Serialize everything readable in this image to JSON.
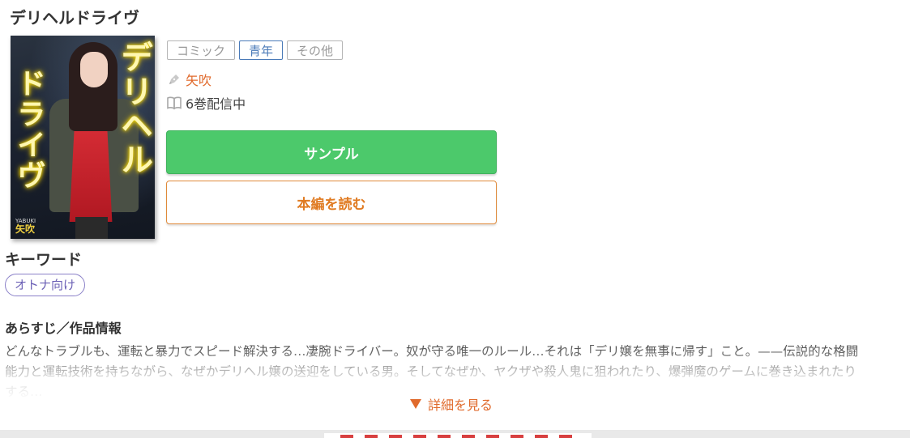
{
  "title": "デリヘルドライヴ",
  "cover": {
    "title_right": "デリヘル",
    "title_left": "ドライヴ",
    "brand": "YABUKI",
    "author": "矢吹"
  },
  "genres": [
    {
      "label": "コミック",
      "active": false
    },
    {
      "label": "青年",
      "active": true
    },
    {
      "label": "その他",
      "active": false
    }
  ],
  "author": {
    "name": "矢吹",
    "icon": "pen-icon"
  },
  "volumes": {
    "text": "6巻配信中",
    "icon": "book-icon"
  },
  "buttons": {
    "sample": "サンプル",
    "read": "本編を読む"
  },
  "keywords": {
    "heading": "キーワード",
    "items": [
      "オトナ向け"
    ]
  },
  "synopsis": {
    "heading": "あらすじ／作品情報",
    "lines": [
      "どんなトラブルも、運転と暴力でスピード解決する…凄腕ドライバー。奴が守る唯一のルール…それは「デリ嬢を無事に帰す」こと。——伝説的な格闘",
      "能力と運転技術を持ちながら、なぜかデリヘル嬢の送迎をしている男。そしてなぜか、ヤクザや殺人鬼に狙われたり、爆弾魔のゲームに巻き込まれたり",
      "する…"
    ]
  },
  "more_link": {
    "label": "詳細を見る",
    "icon": "triangle-down-icon"
  },
  "colors": {
    "accent_orange": "#e06a2c",
    "sample_green": "#4cc96b",
    "tag_blue": "#4a7ab8",
    "keyword_purple": "#6a5fb5"
  }
}
